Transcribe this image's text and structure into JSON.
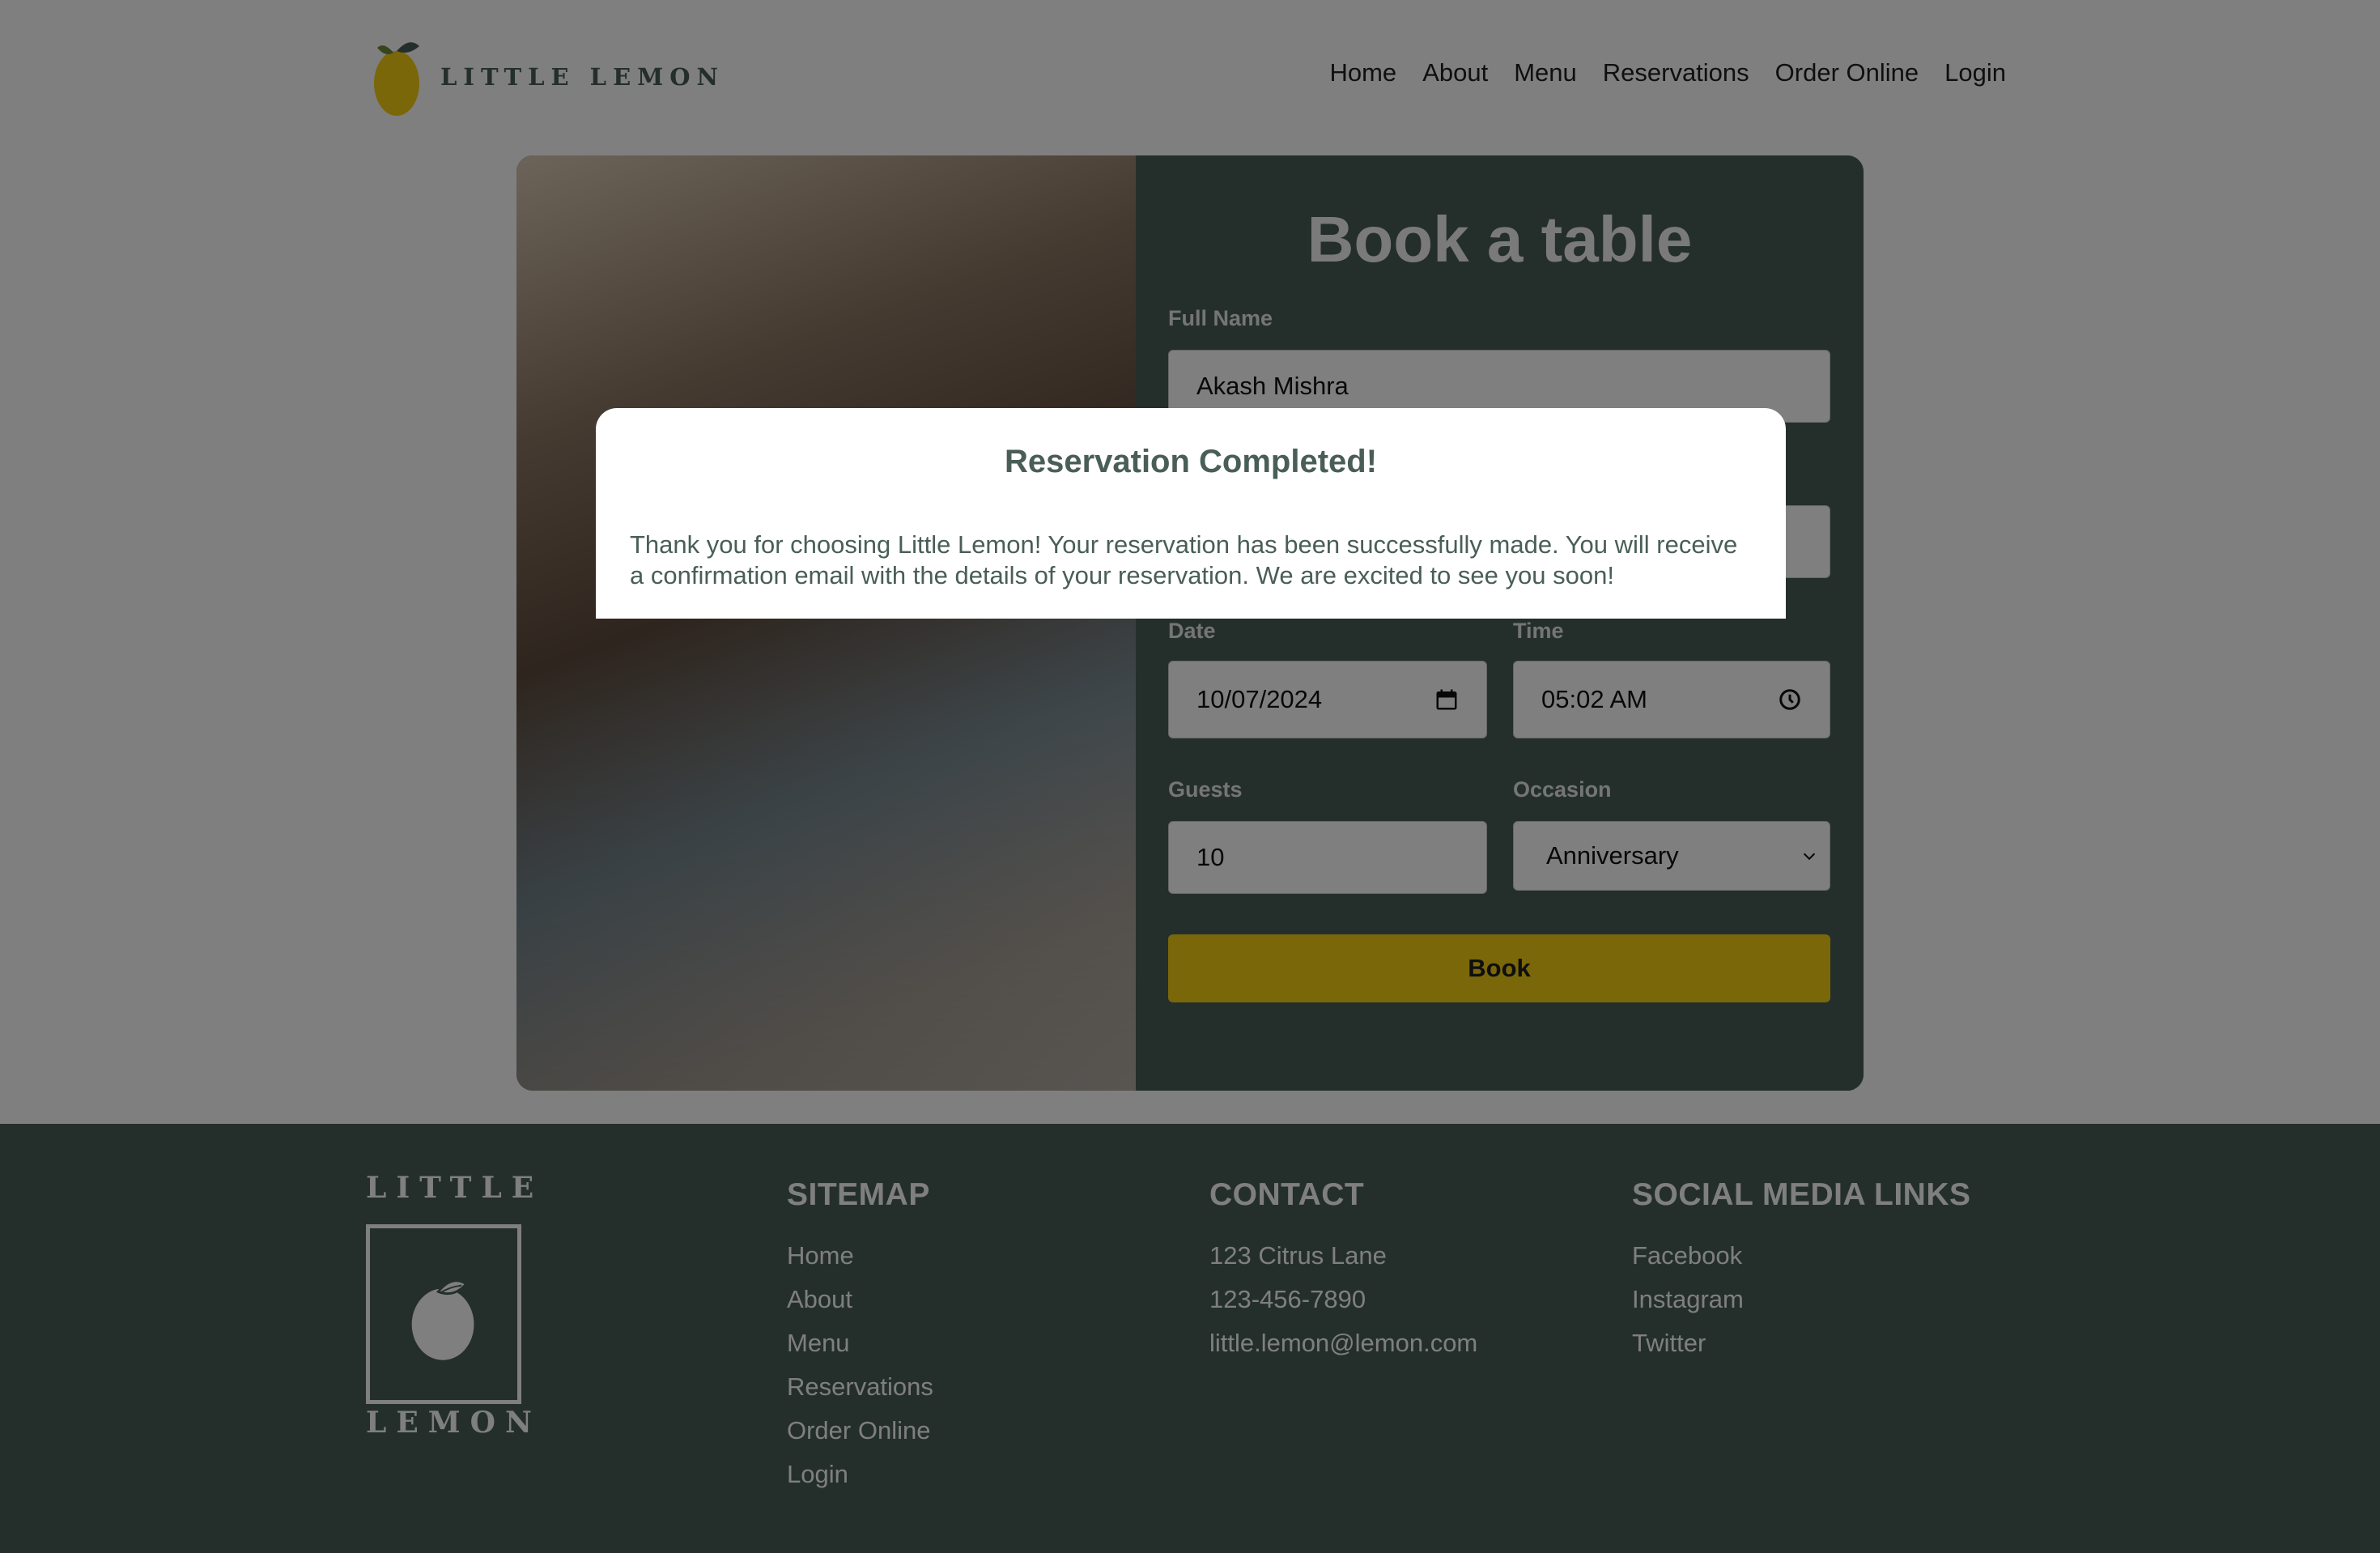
{
  "header": {
    "logo_text": "LITTLE LEMON",
    "nav": [
      "Home",
      "About",
      "Menu",
      "Reservations",
      "Order Online",
      "Login"
    ]
  },
  "booking": {
    "title": "Book a table",
    "full_name_label": "Full Name",
    "full_name_value": "Akash Mishra",
    "date_label": "Date",
    "date_value": "10/07/2024",
    "time_label": "Time",
    "time_value": "05:02 AM",
    "guests_label": "Guests",
    "guests_value": "10",
    "occasion_label": "Occasion",
    "occasion_value": "Anniversary",
    "book_label": "Book"
  },
  "modal": {
    "title": "Reservation Completed!",
    "body": "Thank you for choosing Little Lemon! Your reservation has been successfully made. You will receive a confirmation email with the details of your reservation. We are excited to see you soon!"
  },
  "footer": {
    "logo_top": "LITTLE",
    "logo_bottom": "LEMON",
    "sitemap_title": "SITEMAP",
    "sitemap": [
      "Home",
      "About",
      "Menu",
      "Reservations",
      "Order Online",
      "Login"
    ],
    "contact_title": "CONTACT",
    "contact": [
      "123 Citrus Lane",
      "123-456-7890",
      "little.lemon@lemon.com"
    ],
    "social_title": "SOCIAL MEDIA LINKS",
    "social": [
      "Facebook",
      "Instagram",
      "Twitter"
    ]
  },
  "colors": {
    "brand_green": "#495e57",
    "brand_yellow": "#f4ce14"
  },
  "icons": {
    "logo": "lemon-icon",
    "date": "calendar-icon",
    "time": "clock-icon",
    "select": "chevron-down-icon"
  }
}
